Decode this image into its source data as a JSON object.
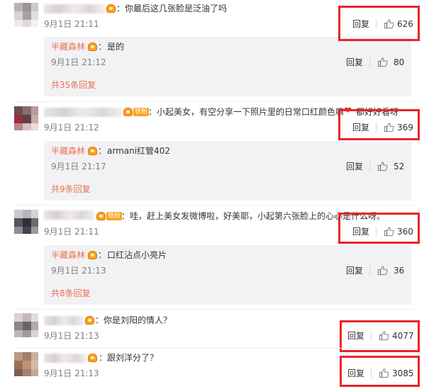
{
  "comments": [
    {
      "text": "你最后这几张脸是泛油了吗",
      "time": "9月1日 21:11",
      "reply_label": "回复",
      "likes": "626",
      "sub": {
        "name": "半藏森林",
        "text": "是的",
        "time": "9月1日 21:12",
        "reply_label": "回复",
        "likes": "80",
        "more": "共35条回复"
      }
    },
    {
      "badge": "铁粉",
      "text": "小起美女，有空分享一下照片里的日常口红颜色嘛",
      "text_tail": "都好好看呀",
      "time": "9月1日 21:12",
      "reply_label": "回复",
      "likes": "369",
      "sub": {
        "name": "半藏森林",
        "text": "armani红管402",
        "time": "9月1日 21:17",
        "reply_label": "回复",
        "likes": "52",
        "more": "共9条回复"
      }
    },
    {
      "badge": "铁粉",
      "text": "哇，赶上美女发微博啦，好美耶，小起第六张脸上的心心是什么呀。",
      "time": "9月1日 21:11",
      "reply_label": "回复",
      "likes": "360",
      "sub": {
        "name": "半藏森林",
        "text": "口红沾点小亮片",
        "time": "9月1日 21:13",
        "reply_label": "回复",
        "likes": "36",
        "more": "共8条回复"
      }
    },
    {
      "text": "你是刘阳的情人？",
      "time": "9月1日 21:13",
      "reply_label": "回复",
      "likes": "4077"
    },
    {
      "text": "跟刘洋分了？",
      "time": "9月1日 21:13",
      "reply_label": "回复",
      "likes": "3085"
    }
  ],
  "colon": "：",
  "colors": {
    "highlight_border": "#e8242b",
    "username_link": "#eb7350",
    "reply_box_bg": "#f2f2f5",
    "vip_badge": "#f7a51c"
  }
}
